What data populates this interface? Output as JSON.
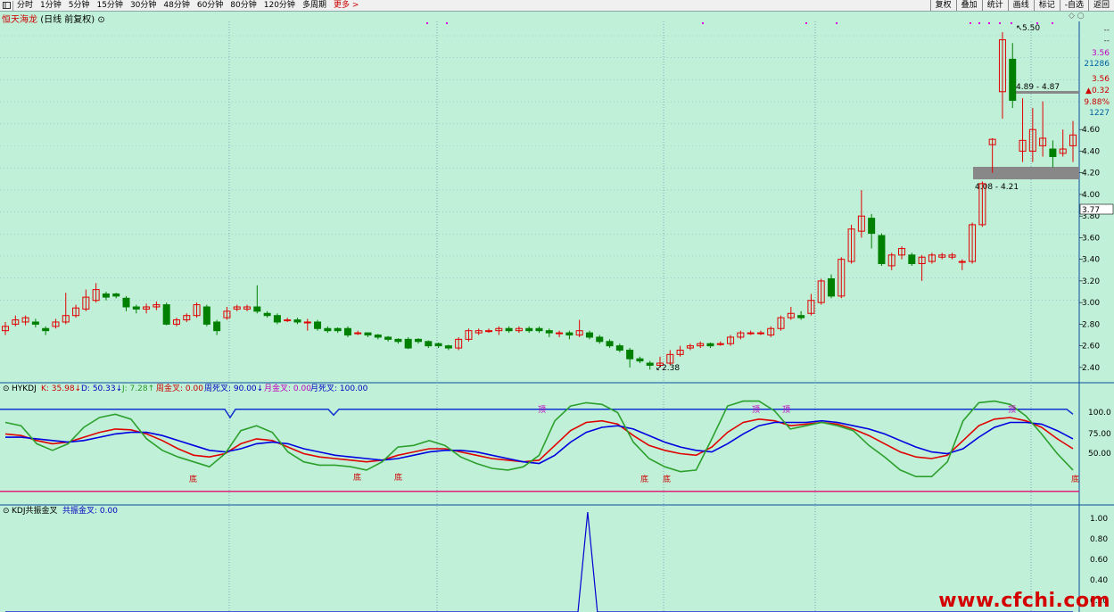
{
  "toolbar": {
    "periods": [
      "分时",
      "1分钟",
      "5分钟",
      "15分钟",
      "30分钟",
      "48分钟",
      "60分钟",
      "80分钟",
      "120分钟",
      "多周期"
    ],
    "more": "更多 >",
    "right": [
      "复权",
      "叠加",
      "统计",
      "画线",
      "标记",
      "-自选",
      "返回"
    ]
  },
  "title": {
    "name": "恒天海龙",
    "mode": "(日线 前复权)"
  },
  "price_axis": {
    "ticks": [
      "4.60",
      "4.40",
      "4.20",
      "4.00",
      "3.80",
      "3.60",
      "3.40",
      "3.20",
      "3.00",
      "2.80",
      "2.60",
      "2.40"
    ],
    "info": [
      "--",
      "--",
      "3.56",
      "21286",
      "3.56",
      "▲0.32",
      "9.88%",
      "1227"
    ],
    "cursor_price": "3.77"
  },
  "annotations": {
    "high_label": "5.50",
    "low_label": "2.38",
    "gap_upper_label": "4.89 - 4.87",
    "gap_lower_label": "4.08 - 4.21"
  },
  "kdj_panel": {
    "label": "HYKDJ",
    "k_label": "K: 35.98↓",
    "d_label": "D: 50.33↓",
    "j_label": "J: 7.28↑",
    "zj_label": "周金叉: 0.00",
    "zs_label": "周死叉: 90.00↓",
    "yj_label": "月金叉: 0.00",
    "ys_label": "月死叉: 100.00",
    "ticks": [
      "100.0",
      "75.00",
      "50.00"
    ],
    "mark_top": "顶",
    "mark_bottom": "底"
  },
  "resonance_panel": {
    "label": "KDJ共振金叉",
    "value_label": "共振金叉: 0.00",
    "ticks": [
      "1.00",
      "0.80",
      "0.60",
      "0.40",
      "0.20"
    ]
  },
  "watermark": "www.cfchi.com",
  "colors": {
    "up": "#e00000",
    "down": "#008000",
    "k": "#e00000",
    "d": "#0000e0",
    "j": "#2ca02c",
    "bg": "#c0f0d8"
  },
  "chart_data": [
    {
      "type": "candlestick",
      "title": "恒天海龙 (日线 前复权)",
      "ylim": [
        2.3,
        5.6
      ],
      "high": 5.5,
      "low": 2.38,
      "close_last": 4.55,
      "candles": [
        [
          2.74,
          2.78,
          2.7,
          2.82
        ],
        [
          2.8,
          2.84,
          2.78,
          2.88
        ],
        [
          2.82,
          2.86,
          2.79,
          2.88
        ],
        [
          2.82,
          2.8,
          2.77,
          2.85
        ],
        [
          2.76,
          2.74,
          2.7,
          2.78
        ],
        [
          2.78,
          2.82,
          2.76,
          2.85
        ],
        [
          2.82,
          2.88,
          2.8,
          3.09
        ],
        [
          2.88,
          2.95,
          2.86,
          2.98
        ],
        [
          2.94,
          3.05,
          2.92,
          3.12
        ],
        [
          3.02,
          3.12,
          3.0,
          3.18
        ],
        [
          3.08,
          3.05,
          3.02,
          3.1
        ],
        [
          3.08,
          3.06,
          3.04,
          3.09
        ],
        [
          3.04,
          2.96,
          2.92,
          3.06
        ],
        [
          2.96,
          2.94,
          2.9,
          2.98
        ],
        [
          2.94,
          2.96,
          2.9,
          2.99
        ],
        [
          2.96,
          2.98,
          2.93,
          3.01
        ],
        [
          2.98,
          2.8,
          2.79,
          3.0
        ],
        [
          2.8,
          2.84,
          2.78,
          2.86
        ],
        [
          2.84,
          2.88,
          2.82,
          2.9
        ],
        [
          2.88,
          2.98,
          2.86,
          3.0
        ],
        [
          2.96,
          2.8,
          2.78,
          2.98
        ],
        [
          2.82,
          2.74,
          2.7,
          2.84
        ],
        [
          2.86,
          2.92,
          2.84,
          2.96
        ],
        [
          2.94,
          2.96,
          2.92,
          2.98
        ],
        [
          2.94,
          2.96,
          2.92,
          2.98
        ],
        [
          2.96,
          2.92,
          2.9,
          3.16
        ],
        [
          2.9,
          2.88,
          2.86,
          2.92
        ],
        [
          2.88,
          2.82,
          2.8,
          2.9
        ],
        [
          2.84,
          2.84,
          2.82,
          2.86
        ],
        [
          2.84,
          2.82,
          2.8,
          2.86
        ],
        [
          2.82,
          2.82,
          2.74,
          2.85
        ],
        [
          2.82,
          2.76,
          2.74,
          2.84
        ],
        [
          2.76,
          2.74,
          2.72,
          2.78
        ],
        [
          2.76,
          2.74,
          2.72,
          2.77
        ],
        [
          2.76,
          2.7,
          2.68,
          2.78
        ],
        [
          2.72,
          2.72,
          2.7,
          2.74
        ],
        [
          2.72,
          2.7,
          2.68,
          2.72
        ],
        [
          2.7,
          2.68,
          2.66,
          2.71
        ],
        [
          2.68,
          2.66,
          2.64,
          2.69
        ],
        [
          2.66,
          2.64,
          2.62,
          2.67
        ],
        [
          2.66,
          2.58,
          2.57,
          2.68
        ],
        [
          2.66,
          2.64,
          2.62,
          2.67
        ],
        [
          2.64,
          2.6,
          2.58,
          2.65
        ],
        [
          2.62,
          2.6,
          2.58,
          2.63
        ],
        [
          2.6,
          2.58,
          2.56,
          2.61
        ],
        [
          2.58,
          2.66,
          2.56,
          2.68
        ],
        [
          2.66,
          2.74,
          2.64,
          2.76
        ],
        [
          2.72,
          2.74,
          2.7,
          2.76
        ],
        [
          2.74,
          2.74,
          2.72,
          2.76
        ],
        [
          2.74,
          2.76,
          2.7,
          2.78
        ],
        [
          2.76,
          2.74,
          2.72,
          2.78
        ],
        [
          2.74,
          2.76,
          2.72,
          2.78
        ],
        [
          2.76,
          2.74,
          2.72,
          2.78
        ],
        [
          2.76,
          2.74,
          2.72,
          2.78
        ],
        [
          2.74,
          2.72,
          2.68,
          2.76
        ],
        [
          2.72,
          2.72,
          2.68,
          2.74
        ],
        [
          2.72,
          2.7,
          2.66,
          2.74
        ],
        [
          2.7,
          2.74,
          2.68,
          2.84
        ],
        [
          2.72,
          2.68,
          2.66,
          2.74
        ],
        [
          2.68,
          2.64,
          2.62,
          2.7
        ],
        [
          2.64,
          2.6,
          2.58,
          2.66
        ],
        [
          2.6,
          2.56,
          2.54,
          2.62
        ],
        [
          2.56,
          2.48,
          2.4,
          2.58
        ],
        [
          2.48,
          2.46,
          2.44,
          2.5
        ],
        [
          2.44,
          2.42,
          2.38,
          2.46
        ],
        [
          2.42,
          2.44,
          2.4,
          2.5
        ],
        [
          2.44,
          2.52,
          2.42,
          2.56
        ],
        [
          2.52,
          2.56,
          2.5,
          2.6
        ],
        [
          2.58,
          2.6,
          2.56,
          2.62
        ],
        [
          2.6,
          2.62,
          2.58,
          2.64
        ],
        [
          2.62,
          2.6,
          2.58,
          2.63
        ],
        [
          2.62,
          2.62,
          2.6,
          2.64
        ],
        [
          2.62,
          2.68,
          2.6,
          2.7
        ],
        [
          2.68,
          2.72,
          2.66,
          2.74
        ],
        [
          2.72,
          2.72,
          2.7,
          2.74
        ],
        [
          2.72,
          2.72,
          2.7,
          2.74
        ],
        [
          2.7,
          2.76,
          2.68,
          2.78
        ],
        [
          2.76,
          2.86,
          2.74,
          2.88
        ],
        [
          2.86,
          2.9,
          2.84,
          2.96
        ],
        [
          2.88,
          2.86,
          2.84,
          2.92
        ],
        [
          2.9,
          3.02,
          2.88,
          3.08
        ],
        [
          3.0,
          3.2,
          2.98,
          3.22
        ],
        [
          3.22,
          3.06,
          3.04,
          3.26
        ],
        [
          3.06,
          3.4,
          3.04,
          3.42
        ],
        [
          3.38,
          3.68,
          3.36,
          3.72
        ],
        [
          3.66,
          3.8,
          3.6,
          4.04
        ],
        [
          3.78,
          3.64,
          3.5,
          3.82
        ],
        [
          3.62,
          3.36,
          3.34,
          3.64
        ],
        [
          3.34,
          3.44,
          3.3,
          3.46
        ],
        [
          3.44,
          3.5,
          3.4,
          3.52
        ],
        [
          3.44,
          3.36,
          3.34,
          3.46
        ],
        [
          3.36,
          3.42,
          3.2,
          3.44
        ],
        [
          3.38,
          3.44,
          3.36,
          3.46
        ],
        [
          3.42,
          3.44,
          3.4,
          3.46
        ],
        [
          3.42,
          3.44,
          3.4,
          3.46
        ],
        [
          3.38,
          3.38,
          3.3,
          3.4
        ],
        [
          3.38,
          3.72,
          3.36,
          3.74
        ],
        [
          3.72,
          4.1,
          3.7,
          4.12
        ],
        [
          4.46,
          4.51,
          4.2,
          4.52
        ],
        [
          4.95,
          5.43,
          4.7,
          5.5
        ],
        [
          5.25,
          4.87,
          4.8,
          5.4
        ],
        [
          4.4,
          4.5,
          4.3,
          4.89
        ],
        [
          4.4,
          4.6,
          4.3,
          4.8
        ],
        [
          4.45,
          4.52,
          4.35,
          4.86
        ],
        [
          4.42,
          4.35,
          4.25,
          4.5
        ],
        [
          4.38,
          4.42,
          4.35,
          4.6
        ],
        [
          4.45,
          4.55,
          4.3,
          4.68
        ]
      ]
    },
    {
      "type": "line",
      "title": "HYKDJ",
      "ylim": [
        -10,
        115
      ],
      "series": [
        {
          "name": "K",
          "values": [
            70,
            68,
            62,
            58,
            60,
            66,
            72,
            76,
            75,
            70,
            62,
            52,
            44,
            42,
            46,
            58,
            64,
            62,
            54,
            46,
            42,
            40,
            38,
            36,
            38,
            44,
            48,
            52,
            52,
            48,
            44,
            40,
            38,
            36,
            38,
            56,
            74,
            84,
            86,
            82,
            68,
            56,
            50,
            46,
            44,
            54,
            72,
            84,
            88,
            86,
            80,
            82,
            84,
            82,
            76,
            68,
            58,
            48,
            42,
            40,
            44,
            62,
            80,
            88,
            90,
            86,
            78,
            64,
            52
          ]
        },
        {
          "name": "D",
          "values": [
            66,
            66,
            64,
            62,
            60,
            62,
            66,
            70,
            72,
            72,
            68,
            62,
            56,
            50,
            48,
            52,
            58,
            60,
            58,
            52,
            48,
            44,
            42,
            40,
            38,
            40,
            44,
            48,
            50,
            50,
            48,
            44,
            40,
            36,
            34,
            44,
            60,
            72,
            78,
            80,
            76,
            68,
            60,
            54,
            50,
            48,
            58,
            70,
            80,
            84,
            84,
            84,
            86,
            84,
            80,
            76,
            70,
            62,
            54,
            48,
            46,
            52,
            66,
            78,
            84,
            84,
            82,
            74,
            64
          ]
        },
        {
          "name": "J",
          "values": [
            84,
            80,
            58,
            50,
            58,
            78,
            90,
            94,
            88,
            64,
            50,
            42,
            36,
            30,
            46,
            74,
            80,
            72,
            48,
            36,
            32,
            32,
            30,
            26,
            36,
            54,
            56,
            62,
            56,
            42,
            34,
            28,
            26,
            30,
            44,
            86,
            104,
            108,
            106,
            96,
            60,
            40,
            30,
            24,
            26,
            64,
            104,
            110,
            110,
            98,
            76,
            80,
            84,
            80,
            74,
            56,
            42,
            26,
            18,
            18,
            36,
            86,
            108,
            110,
            106,
            92,
            70,
            46,
            26
          ]
        }
      ]
    },
    {
      "type": "line",
      "title": "KDJ共振金叉",
      "ylim": [
        0,
        1
      ],
      "series": [
        {
          "name": "共振金叉",
          "values": [
            0,
            0,
            0,
            0,
            0,
            0,
            0,
            0,
            0,
            0,
            0,
            0,
            0,
            0,
            0,
            0,
            0,
            0,
            0,
            0,
            0,
            0,
            0,
            0,
            0,
            0,
            0,
            0,
            0,
            0,
            0,
            0,
            0,
            0,
            0,
            0,
            0,
            0,
            0,
            0,
            0,
            0,
            0,
            0,
            0,
            0,
            0,
            0,
            0,
            0,
            0,
            0,
            0,
            0,
            0,
            0,
            0,
            0,
            0,
            0,
            1,
            0,
            0,
            0,
            0,
            0,
            0,
            0,
            0,
            0,
            0,
            0,
            0,
            0,
            0,
            0,
            0,
            0,
            0,
            0,
            0,
            0,
            0,
            0,
            0,
            0,
            0,
            0,
            0,
            0,
            0,
            0,
            0,
            0,
            0,
            0,
            0,
            0,
            0,
            0,
            0,
            0,
            0,
            0,
            0,
            0,
            0,
            0,
            0,
            0,
            0
          ]
        }
      ]
    }
  ]
}
